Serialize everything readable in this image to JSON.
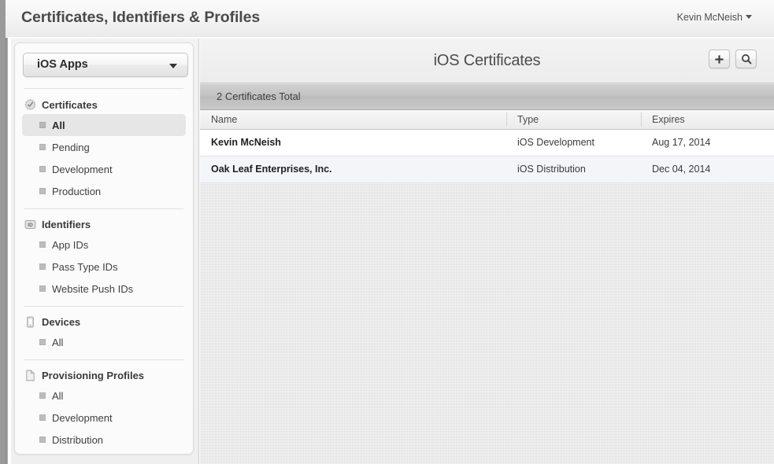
{
  "window": {
    "app_title": "Certificates, Identifiers & Profiles",
    "account_name": "Kevin McNeish"
  },
  "sidebar": {
    "team_select": {
      "value": "iOS Apps",
      "caret_icon": "chevron-down-icon"
    },
    "groups": [
      {
        "title": "Certificates",
        "icon": "certificate-seal-icon",
        "items": [
          {
            "label": "All",
            "selected": true
          },
          {
            "label": "Pending",
            "selected": false
          },
          {
            "label": "Development",
            "selected": false
          },
          {
            "label": "Production",
            "selected": false
          }
        ]
      },
      {
        "title": "Identifiers",
        "icon": "id-badge-icon",
        "items": [
          {
            "label": "App IDs",
            "selected": false
          },
          {
            "label": "Pass Type IDs",
            "selected": false
          },
          {
            "label": "Website Push IDs",
            "selected": false
          }
        ]
      },
      {
        "title": "Devices",
        "icon": "device-phone-icon",
        "items": [
          {
            "label": "All",
            "selected": false
          }
        ]
      },
      {
        "title": "Provisioning Profiles",
        "icon": "document-page-icon",
        "items": [
          {
            "label": "All",
            "selected": false
          },
          {
            "label": "Development",
            "selected": false
          },
          {
            "label": "Distribution",
            "selected": false
          }
        ]
      }
    ]
  },
  "main": {
    "title": "iOS Certificates",
    "buttons": [
      {
        "name": "add-button",
        "icon": "plus-icon",
        "glyph": "+"
      },
      {
        "name": "search-button",
        "icon": "search-magnifier-icon",
        "glyph": "⌕"
      }
    ],
    "count_text": "2 Certificates Total",
    "table": {
      "columns": [
        "Name",
        "Type",
        "Expires"
      ],
      "rows": [
        {
          "name": "Kevin McNeish",
          "type": "iOS Development",
          "expires": "Aug 17, 2014"
        },
        {
          "name": "Oak Leaf Enterprises, Inc.",
          "type": "iOS Distribution",
          "expires": "Dec 04, 2014"
        }
      ]
    }
  },
  "colors": {
    "topbar_text": "#4a4a4a",
    "count_bar": "#c2c2c2",
    "row_alt": "#f3f5f8",
    "selected_nav": "#e6e6e6",
    "canvas": "#e3e3e3"
  }
}
